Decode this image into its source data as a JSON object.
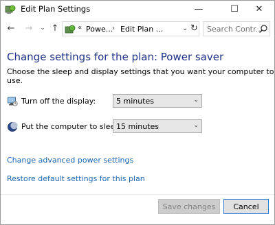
{
  "window": {
    "title": "Edit Plan Settings",
    "controls": {
      "minimize": "—",
      "maximize": "☐",
      "close": "✕"
    }
  },
  "nav": {
    "back": "←",
    "forward": "→",
    "recent": "⌄",
    "up": "↑",
    "address": {
      "chevron": "«",
      "crumbs": [
        "Powe...",
        "Edit Plan ..."
      ],
      "separator": "›",
      "dropdown": "⌄",
      "refresh": "↻"
    },
    "search": {
      "placeholder": "Search Contr..."
    }
  },
  "main": {
    "heading": "Change settings for the plan: Power saver",
    "description": "Choose the sleep and display settings that you want your computer to use.",
    "settings": [
      {
        "label": "Turn off the display:",
        "value": "5 minutes",
        "icon": "monitor-icon"
      },
      {
        "label": "Put the computer to sleep:",
        "value": "15 minutes",
        "icon": "moon-icon"
      }
    ],
    "links": {
      "advanced": "Change advanced power settings",
      "restore": "Restore default settings for this plan"
    }
  },
  "footer": {
    "save_label": "Save changes",
    "cancel_label": "Cancel"
  },
  "colors": {
    "heading": "#1e3287",
    "link": "#1b66b3",
    "focus": "#2f7bd1"
  }
}
